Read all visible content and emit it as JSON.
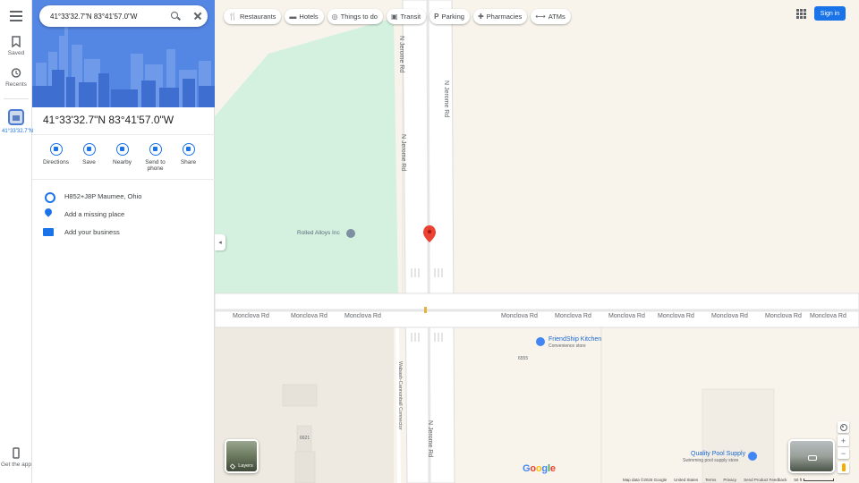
{
  "search": {
    "value": "41°33'32.7\"N 83°41'57.0\"W"
  },
  "rail": {
    "saved": "Saved",
    "recents": "Recents",
    "recent_item": "41°33'32.7\"N",
    "get_app": "Get the app"
  },
  "place": {
    "title": "41°33'32.7\"N 83°41'57.0\"W",
    "actions": [
      {
        "label": "Directions",
        "icon": "directions-icon"
      },
      {
        "label": "Save",
        "icon": "bookmark-icon"
      },
      {
        "label": "Nearby",
        "icon": "nearby-icon"
      },
      {
        "label": "Send to phone",
        "icon": "phone-icon"
      },
      {
        "label": "Share",
        "icon": "share-icon"
      }
    ],
    "plus_code": "H852+J8P Maumee, Ohio",
    "add_missing_place": "Add a missing place",
    "add_business": "Add your business"
  },
  "chips": [
    {
      "label": "Restaurants",
      "icon": "restaurant-icon"
    },
    {
      "label": "Hotels",
      "icon": "hotel-icon"
    },
    {
      "label": "Things to do",
      "icon": "camera-icon"
    },
    {
      "label": "Transit",
      "icon": "transit-icon"
    },
    {
      "label": "Parking",
      "icon": "parking-icon"
    },
    {
      "label": "Pharmacies",
      "icon": "pharmacy-icon"
    },
    {
      "label": "ATMs",
      "icon": "atm-icon"
    }
  ],
  "header": {
    "signin": "Sign in"
  },
  "map": {
    "roads": {
      "monclova": "Monclova Rd",
      "jerome": "N Jerome Rd",
      "connector": "Wabash-Cannonball Connector"
    },
    "places": {
      "rolled_alloys": "Rolled Alloys Inc",
      "friendship_kitchen": "FriendShip Kitchen",
      "friendship_sub": "Convenience store",
      "quality_pool": "Quality Pool Supply",
      "quality_pool_sub": "Swimming pool supply store"
    },
    "numbers": {
      "n6555": "6555",
      "n6621": "6621"
    },
    "layers_label": "Layers",
    "colors": {
      "land": "#f8f4ec",
      "green": "#d4f1df",
      "road": "#ffffff",
      "pin": "#ea4335"
    }
  },
  "footer": {
    "map_data": "Map data ©2025 Google",
    "country": "United States",
    "terms": "Terms",
    "privacy": "Privacy",
    "feedback": "Send Product Feedback",
    "scale": "50 ft"
  },
  "logo": "Google"
}
